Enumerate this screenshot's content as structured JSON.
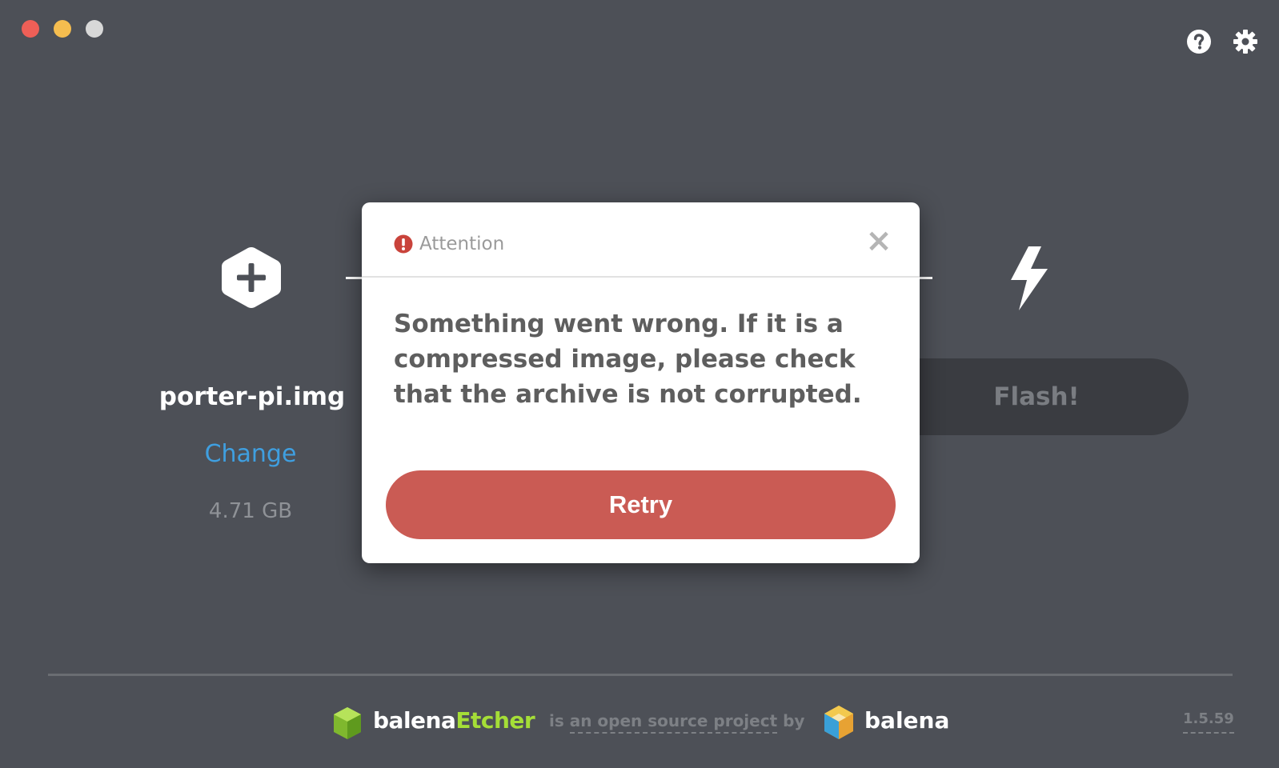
{
  "window": {
    "controls": [
      "close",
      "minimize",
      "maximize"
    ]
  },
  "toolbar": {
    "help_icon": "help-icon",
    "settings_icon": "gear-icon"
  },
  "image_step": {
    "icon": "plus-hexagon-icon",
    "file_name": "porter-pi.img",
    "change_label": "Change",
    "size": "4.71 GB"
  },
  "flash_step": {
    "icon": "lightning-bolt-icon",
    "button_label": "Flash!"
  },
  "modal": {
    "title": "Attention",
    "icon": "exclamation-circle-icon",
    "close_label": "×",
    "message": "Something went wrong. If it is a compressed image, please check that the archive is not corrupted.",
    "retry_label": "Retry"
  },
  "footer": {
    "etcher_brand_prefix": "balena",
    "etcher_brand_suffix": "Etcher",
    "open_source_text": "is an open source project by",
    "open_source_prefix": "is ",
    "open_source_link": "an open source project",
    "open_source_suffix": " by",
    "balena_brand": "balena",
    "version": "1.5.59"
  },
  "colors": {
    "background": "#4d5057",
    "accent_blue": "#3f9fe0",
    "retry_red": "#ca5b54",
    "etcher_green": "#a5de37"
  }
}
